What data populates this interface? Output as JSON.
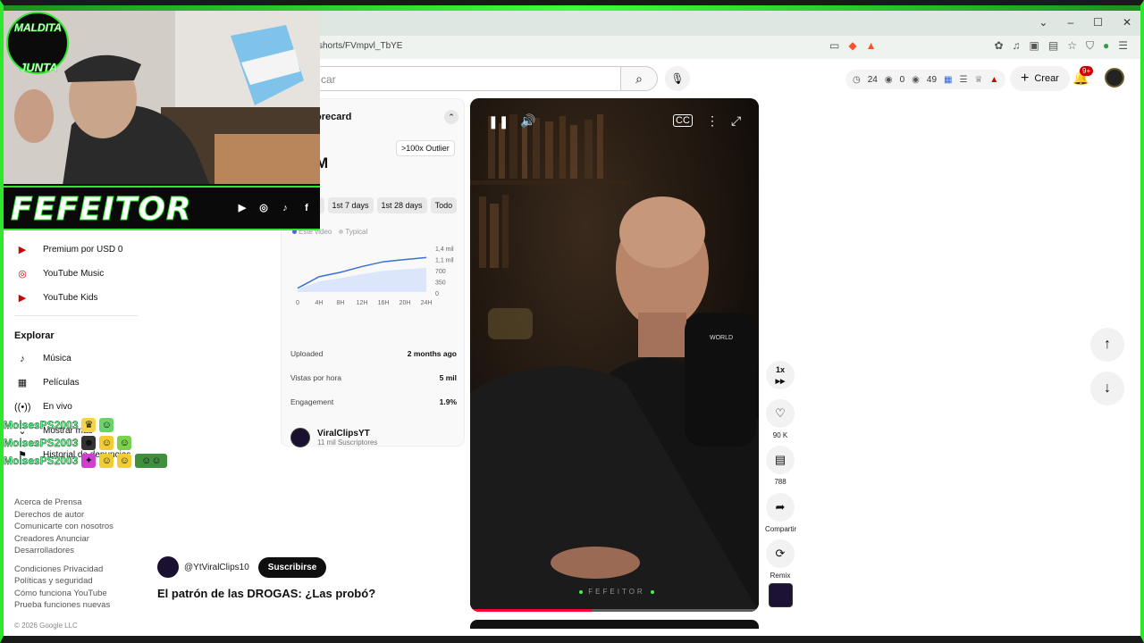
{
  "browser": {
    "url": "shorts/FVmpvl_TbYE"
  },
  "header": {
    "search_placeholder": "car",
    "stats": {
      "views_a": "24",
      "views_b": "0",
      "views_c": "49"
    },
    "create_label": "Crear",
    "notif_badge": "9+"
  },
  "sidebar": {
    "items_top": [
      {
        "label": "Premium por USD 0",
        "icon": "youtube-premium-icon"
      },
      {
        "label": "YouTube Music",
        "icon": "youtube-music-icon"
      },
      {
        "label": "YouTube Kids",
        "icon": "youtube-kids-icon"
      }
    ],
    "explore_heading": "Explorar",
    "explore_items": [
      {
        "label": "Música",
        "icon": "music-note-icon"
      },
      {
        "label": "Películas",
        "icon": "film-icon"
      },
      {
        "label": "En vivo",
        "icon": "live-icon"
      }
    ],
    "more_label": "Mostrar más",
    "history_label": "Historial de denuncias",
    "footer": {
      "links1": "Acerca de  Prensa",
      "links2": "Derechos de autor",
      "links3": "Comunicarte con nosotros",
      "links4": "Creadores  Anunciar",
      "links5": "Desarrolladores",
      "links6": "Condiciones  Privacidad",
      "links7": "Políticas y seguridad",
      "links8": "Cómo funciona YouTube",
      "links9": "Prueba funciones nuevas",
      "copyright": "© 2026 Google LLC"
    }
  },
  "scorecard": {
    "title": "orecard",
    "outlier": ">100x Outlier",
    "big_value": "M",
    "tabs": [
      "rs",
      "1st 7 days",
      "1st 28 days",
      "Todo"
    ],
    "legend_this": "Este video",
    "legend_typical": "Typical",
    "chart_data": {
      "type": "line",
      "x": [
        "0",
        "4H",
        "8H",
        "12H",
        "16H",
        "20H",
        "24H"
      ],
      "series": [
        {
          "name": "Este video",
          "values": [
            0.12,
            0.48,
            0.62,
            0.8,
            0.95,
            1.02,
            1.08
          ]
        }
      ],
      "y_ticks": [
        "1,4 mil",
        "1,1 mil",
        "700",
        "350",
        "0"
      ]
    },
    "rows": [
      {
        "label": "Uploaded",
        "value": "2 months ago"
      },
      {
        "label": "Vistas por hora",
        "value": "5 mil"
      },
      {
        "label": "Engagement",
        "value": "1.9%"
      }
    ],
    "channel_name": "ViralClipsYT",
    "channel_subs": "11 mil Suscriptores"
  },
  "video": {
    "progress": 0.42,
    "watermark": "FEFEITOR"
  },
  "rail": {
    "speed": "1x",
    "likes": "90 K",
    "comments": "788",
    "share": "Compartir",
    "remix": "Remix"
  },
  "short": {
    "handle": "@YtViralClips10",
    "subscribe": "Suscribirse",
    "title": "El patrón de las DROGAS: ¿Las probó?"
  },
  "overlay": {
    "brand": "FEFEITOR",
    "logo_line1": "MALDITA",
    "logo_line2": "JUNTA",
    "chat": [
      {
        "user": "MoisesPS2003"
      },
      {
        "user": "MoisesPS2003"
      },
      {
        "user": "MoisesPS2003"
      }
    ]
  }
}
